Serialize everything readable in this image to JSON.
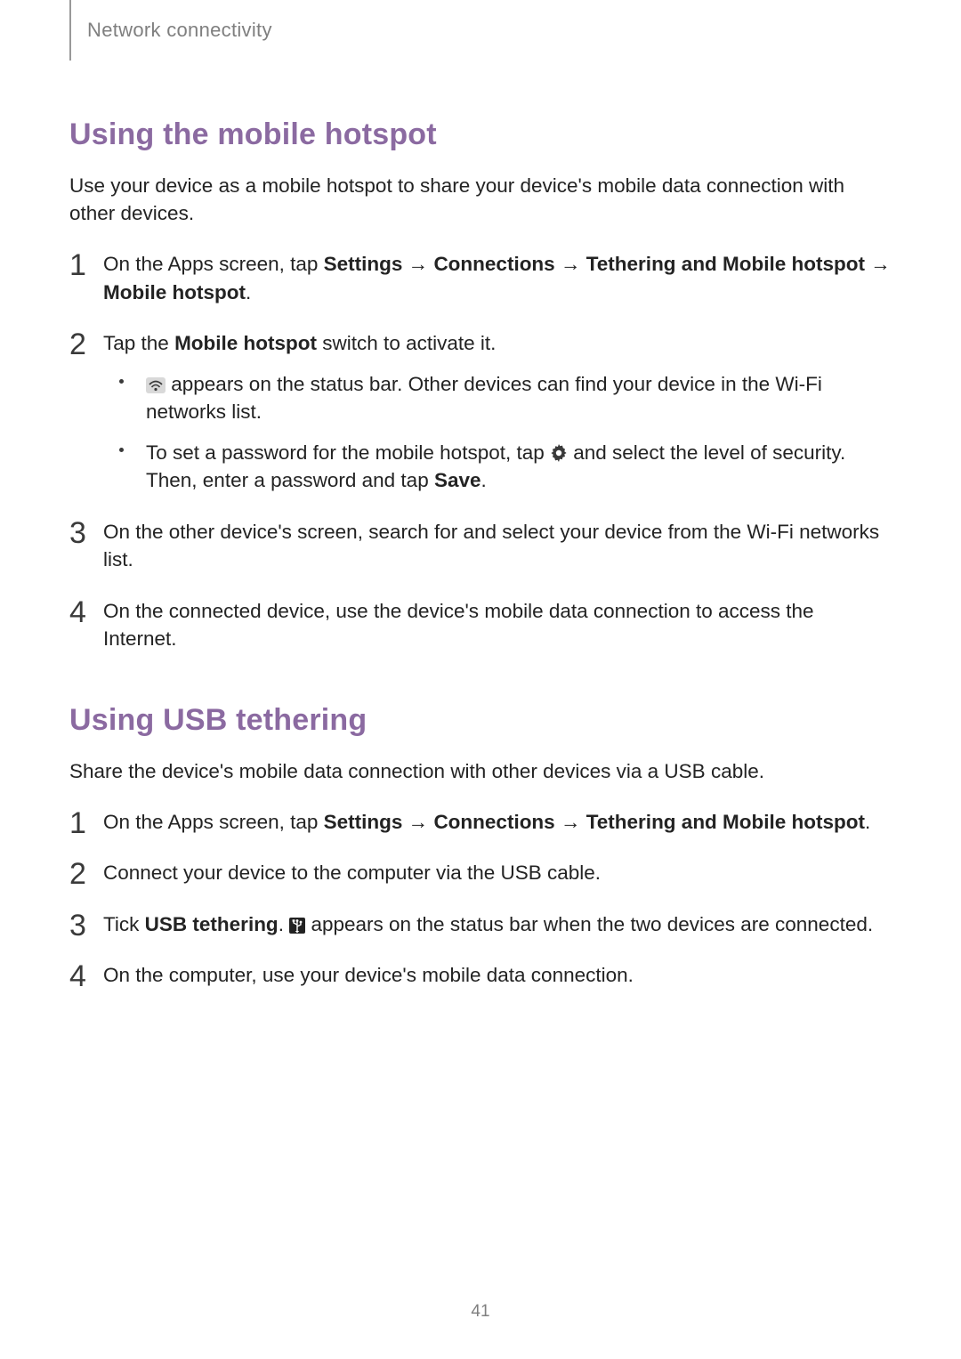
{
  "header": {
    "breadcrumb": "Network connectivity"
  },
  "section1": {
    "title": "Using the mobile hotspot",
    "intro": "Use your device as a mobile hotspot to share your device's mobile data connection with other devices.",
    "steps": {
      "s1": {
        "num": "1",
        "t1": "On the Apps screen, tap ",
        "b1": "Settings",
        "arrow1": " → ",
        "b2": "Connections",
        "arrow2": " → ",
        "b3": "Tethering and Mobile hotspot",
        "arrow3": " → ",
        "b4": "Mobile hotspot",
        "t_end": "."
      },
      "s2": {
        "num": "2",
        "t1": "Tap the ",
        "b1": "Mobile hotspot",
        "t2": " switch to activate it.",
        "sub1": {
          "t1": " appears on the status bar. Other devices can find your device in the Wi-Fi networks list."
        },
        "sub2": {
          "t1": "To set a password for the mobile hotspot, tap ",
          "t2": " and select the level of security. Then, enter a password and tap ",
          "b1": "Save",
          "t3": "."
        }
      },
      "s3": {
        "num": "3",
        "text": "On the other device's screen, search for and select your device from the Wi-Fi networks list."
      },
      "s4": {
        "num": "4",
        "text": "On the connected device, use the device's mobile data connection to access the Internet."
      }
    }
  },
  "section2": {
    "title": "Using USB tethering",
    "intro": "Share the device's mobile data connection with other devices via a USB cable.",
    "steps": {
      "s1": {
        "num": "1",
        "t1": "On the Apps screen, tap ",
        "b1": "Settings",
        "arrow1": " → ",
        "b2": "Connections",
        "arrow2": " → ",
        "b3": "Tethering and Mobile hotspot",
        "t_end": "."
      },
      "s2": {
        "num": "2",
        "text": "Connect your device to the computer via the USB cable."
      },
      "s3": {
        "num": "3",
        "t1": "Tick ",
        "b1": "USB tethering",
        "t2": ". ",
        "t3": " appears on the status bar when the two devices are connected."
      },
      "s4": {
        "num": "4",
        "text": "On the computer, use your device's mobile data connection."
      }
    }
  },
  "page_number": "41"
}
